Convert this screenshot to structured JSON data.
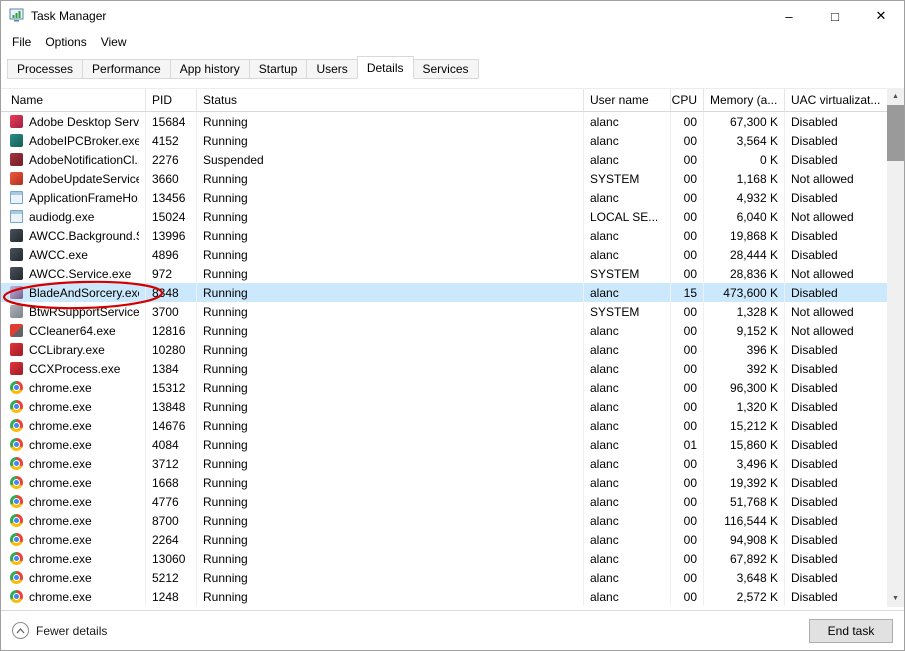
{
  "window": {
    "title": "Task Manager",
    "controls": {
      "minimize": "–",
      "maximize": "□",
      "close": "✕"
    }
  },
  "menu": {
    "items": [
      "File",
      "Options",
      "View"
    ]
  },
  "tabs": [
    "Processes",
    "Performance",
    "App history",
    "Startup",
    "Users",
    "Details",
    "Services"
  ],
  "active_tab": "Details",
  "table": {
    "columns": [
      "Name",
      "PID",
      "Status",
      "User name",
      "CPU",
      "Memory (a...",
      "UAC virtualizat..."
    ],
    "rows": [
      {
        "icon": "adobe-red",
        "name": "Adobe Desktop Servi...",
        "pid": "15684",
        "status": "Running",
        "user": "alanc",
        "cpu": "00",
        "memory": "67,300 K",
        "uac": "Disabled",
        "selected": false
      },
      {
        "icon": "adobe-teal",
        "name": "AdobeIPCBroker.exe",
        "pid": "4152",
        "status": "Running",
        "user": "alanc",
        "cpu": "00",
        "memory": "3,564 K",
        "uac": "Disabled",
        "selected": false
      },
      {
        "icon": "adobe-darkred",
        "name": "AdobeNotificationCl...",
        "pid": "2276",
        "status": "Suspended",
        "user": "alanc",
        "cpu": "00",
        "memory": "0 K",
        "uac": "Disabled",
        "selected": false
      },
      {
        "icon": "adobe-orange",
        "name": "AdobeUpdateService...",
        "pid": "3660",
        "status": "Running",
        "user": "SYSTEM",
        "cpu": "00",
        "memory": "1,168 K",
        "uac": "Not allowed",
        "selected": false
      },
      {
        "icon": "app-window",
        "name": "ApplicationFrameHo...",
        "pid": "13456",
        "status": "Running",
        "user": "alanc",
        "cpu": "00",
        "memory": "4,932 K",
        "uac": "Disabled",
        "selected": false
      },
      {
        "icon": "app-window",
        "name": "audiodg.exe",
        "pid": "15024",
        "status": "Running",
        "user": "LOCAL SE...",
        "cpu": "00",
        "memory": "6,040 K",
        "uac": "Not allowed",
        "selected": false
      },
      {
        "icon": "awcc",
        "name": "AWCC.Background.S...",
        "pid": "13996",
        "status": "Running",
        "user": "alanc",
        "cpu": "00",
        "memory": "19,868 K",
        "uac": "Disabled",
        "selected": false
      },
      {
        "icon": "awcc",
        "name": "AWCC.exe",
        "pid": "4896",
        "status": "Running",
        "user": "alanc",
        "cpu": "00",
        "memory": "28,444 K",
        "uac": "Disabled",
        "selected": false
      },
      {
        "icon": "awcc",
        "name": "AWCC.Service.exe",
        "pid": "972",
        "status": "Running",
        "user": "SYSTEM",
        "cpu": "00",
        "memory": "28,836 K",
        "uac": "Not allowed",
        "selected": false
      },
      {
        "icon": "blade",
        "name": "BladeAndSorcery.exe",
        "pid": "8348",
        "status": "Running",
        "user": "alanc",
        "cpu": "15",
        "memory": "473,600 K",
        "uac": "Disabled",
        "selected": true
      },
      {
        "icon": "service",
        "name": "BtwRSupportService....",
        "pid": "3700",
        "status": "Running",
        "user": "SYSTEM",
        "cpu": "00",
        "memory": "1,328 K",
        "uac": "Not allowed",
        "selected": false
      },
      {
        "icon": "ccleaner",
        "name": "CCleaner64.exe",
        "pid": "12816",
        "status": "Running",
        "user": "alanc",
        "cpu": "00",
        "memory": "9,152 K",
        "uac": "Not allowed",
        "selected": false
      },
      {
        "icon": "cc-red",
        "name": "CCLibrary.exe",
        "pid": "10280",
        "status": "Running",
        "user": "alanc",
        "cpu": "00",
        "memory": "396 K",
        "uac": "Disabled",
        "selected": false
      },
      {
        "icon": "cc-red",
        "name": "CCXProcess.exe",
        "pid": "1384",
        "status": "Running",
        "user": "alanc",
        "cpu": "00",
        "memory": "392 K",
        "uac": "Disabled",
        "selected": false
      },
      {
        "icon": "chrome",
        "name": "chrome.exe",
        "pid": "15312",
        "status": "Running",
        "user": "alanc",
        "cpu": "00",
        "memory": "96,300 K",
        "uac": "Disabled",
        "selected": false
      },
      {
        "icon": "chrome",
        "name": "chrome.exe",
        "pid": "13848",
        "status": "Running",
        "user": "alanc",
        "cpu": "00",
        "memory": "1,320 K",
        "uac": "Disabled",
        "selected": false
      },
      {
        "icon": "chrome",
        "name": "chrome.exe",
        "pid": "14676",
        "status": "Running",
        "user": "alanc",
        "cpu": "00",
        "memory": "15,212 K",
        "uac": "Disabled",
        "selected": false
      },
      {
        "icon": "chrome",
        "name": "chrome.exe",
        "pid": "4084",
        "status": "Running",
        "user": "alanc",
        "cpu": "01",
        "memory": "15,860 K",
        "uac": "Disabled",
        "selected": false
      },
      {
        "icon": "chrome",
        "name": "chrome.exe",
        "pid": "3712",
        "status": "Running",
        "user": "alanc",
        "cpu": "00",
        "memory": "3,496 K",
        "uac": "Disabled",
        "selected": false
      },
      {
        "icon": "chrome",
        "name": "chrome.exe",
        "pid": "1668",
        "status": "Running",
        "user": "alanc",
        "cpu": "00",
        "memory": "19,392 K",
        "uac": "Disabled",
        "selected": false
      },
      {
        "icon": "chrome",
        "name": "chrome.exe",
        "pid": "4776",
        "status": "Running",
        "user": "alanc",
        "cpu": "00",
        "memory": "51,768 K",
        "uac": "Disabled",
        "selected": false
      },
      {
        "icon": "chrome",
        "name": "chrome.exe",
        "pid": "8700",
        "status": "Running",
        "user": "alanc",
        "cpu": "00",
        "memory": "116,544 K",
        "uac": "Disabled",
        "selected": false
      },
      {
        "icon": "chrome",
        "name": "chrome.exe",
        "pid": "2264",
        "status": "Running",
        "user": "alanc",
        "cpu": "00",
        "memory": "94,908 K",
        "uac": "Disabled",
        "selected": false
      },
      {
        "icon": "chrome",
        "name": "chrome.exe",
        "pid": "13060",
        "status": "Running",
        "user": "alanc",
        "cpu": "00",
        "memory": "67,892 K",
        "uac": "Disabled",
        "selected": false
      },
      {
        "icon": "chrome",
        "name": "chrome.exe",
        "pid": "5212",
        "status": "Running",
        "user": "alanc",
        "cpu": "00",
        "memory": "3,648 K",
        "uac": "Disabled",
        "selected": false
      },
      {
        "icon": "chrome",
        "name": "chrome.exe",
        "pid": "1248",
        "status": "Running",
        "user": "alanc",
        "cpu": "00",
        "memory": "2,572 K",
        "uac": "Disabled",
        "selected": false
      }
    ]
  },
  "footer": {
    "fewer_details_label": "Fewer details",
    "end_task_label": "End task"
  },
  "icons": {
    "scroll_up": "▲",
    "scroll_down": "▼"
  },
  "colors": {
    "selected_row": "#cbe8fc",
    "annotation": "#d40000"
  }
}
